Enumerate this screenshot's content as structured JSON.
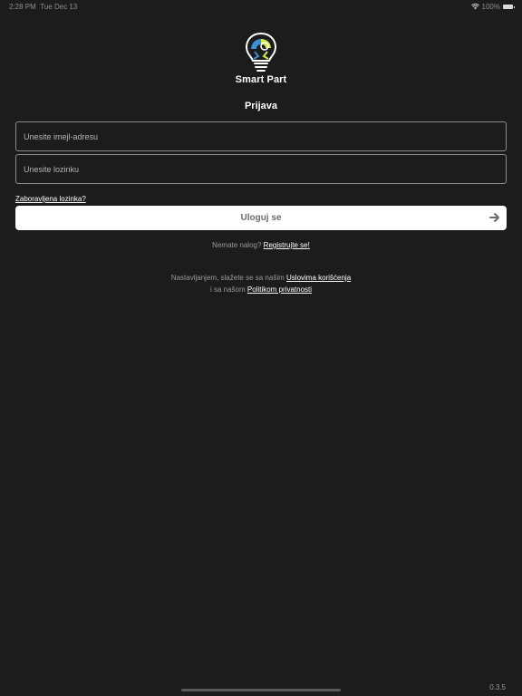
{
  "status_bar": {
    "time": "2:28 PM",
    "date": "Tue Dec 13",
    "battery": "100%"
  },
  "brand": {
    "name": "Smart Part",
    "accent_color": "#d4e84a"
  },
  "login": {
    "title": "Prijava",
    "email_placeholder": "Unesite imejl-adresu",
    "password_placeholder": "Unesite lozinku",
    "forgot_password": "Zaboravljena lozinka?",
    "submit_label": "Uloguj se"
  },
  "register": {
    "prompt": "Nemate nalog?",
    "link": "Registrujte se!"
  },
  "terms": {
    "line1_text": "Nastavljanjem, slažete se sa našim",
    "terms_link": "Uslovima korišćenja",
    "line2_text": "i sa našom",
    "privacy_link": "Politikom privatnosti"
  },
  "version": "0.3.5"
}
